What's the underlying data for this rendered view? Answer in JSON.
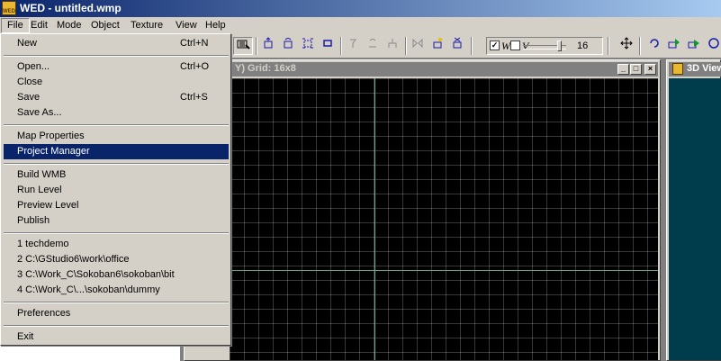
{
  "window": {
    "title": "WED - untitled.wmp",
    "app_icon_text": "WED"
  },
  "menubar": {
    "items": [
      "File",
      "Edit",
      "Mode",
      "Object",
      "Texture",
      "View",
      "Help"
    ]
  },
  "file_menu": {
    "group1": [
      {
        "label": "New",
        "accel": "Ctrl+N"
      }
    ],
    "group2": [
      {
        "label": "Open...",
        "accel": "Ctrl+O"
      },
      {
        "label": "Close",
        "accel": ""
      },
      {
        "label": "Save",
        "accel": "Ctrl+S"
      },
      {
        "label": "Save As...",
        "accel": ""
      }
    ],
    "group3": [
      {
        "label": "Map Properties",
        "accel": ""
      },
      {
        "label": "Project Manager",
        "accel": "",
        "highlighted": true
      }
    ],
    "group4": [
      {
        "label": "Build WMB",
        "accel": ""
      },
      {
        "label": "Run Level",
        "accel": ""
      },
      {
        "label": "Preview Level",
        "accel": ""
      },
      {
        "label": "Publish",
        "accel": ""
      }
    ],
    "recent_files": [
      "1 techdemo",
      "2 C:\\GStudio6\\work\\office",
      "3 C:\\Work_C\\Sokoban6\\sokoban\\bit",
      "4 C:\\Work_C\\...\\sokoban\\dummy"
    ],
    "group6": [
      {
        "label": "Preferences",
        "accel": ""
      }
    ],
    "group7": [
      {
        "label": "Exit",
        "accel": ""
      }
    ]
  },
  "toolbar": {
    "checks": [
      {
        "letter": "W",
        "checked": true
      },
      {
        "letter": "V",
        "checked": false
      }
    ],
    "grid_slider_value": "16"
  },
  "top_view": {
    "caption": "Y) Grid: 16x8"
  },
  "view_3d": {
    "caption": "3D View"
  },
  "colors": {
    "highlight": "#0a246a",
    "grid_background": "#000000",
    "view3d_background": "#003d4c",
    "axis": "#6ba68b"
  }
}
